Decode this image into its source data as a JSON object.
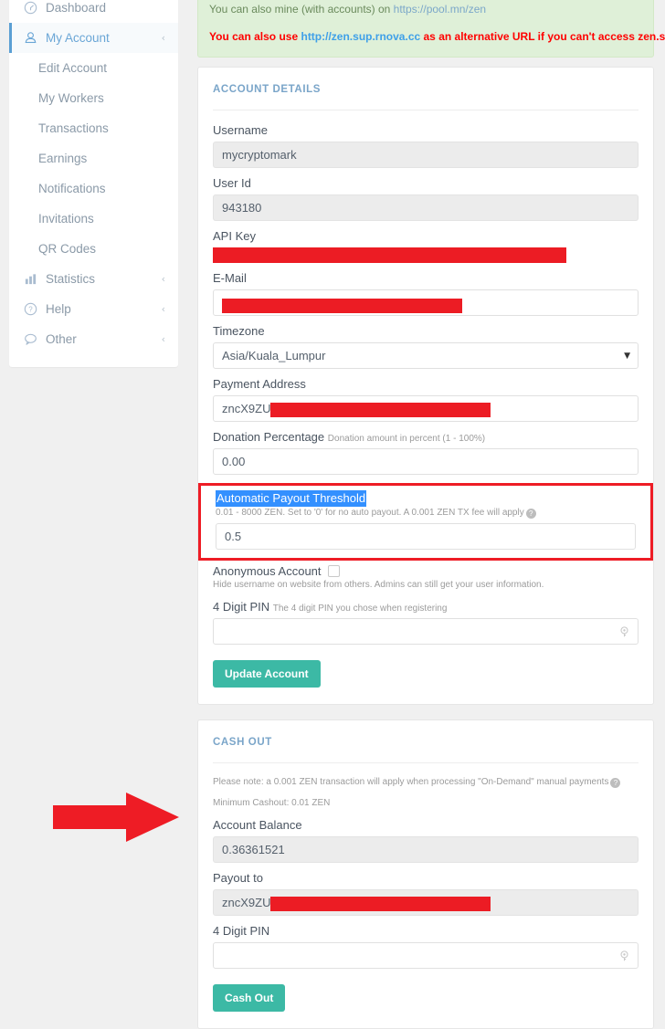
{
  "colors": {
    "accent_blue": "#5a9fd4",
    "panel_title": "#7aa5c9",
    "button_teal": "#3cb9a5",
    "redaction_red": "#ec1c24",
    "annotation_red": "#ee1c25",
    "alert_green_bg": "#dff0d8",
    "selection_blue": "#3390ff"
  },
  "sidebar": {
    "items": [
      {
        "label": "Dashboard",
        "icon": "dashboard-gauge-icon",
        "chevron": "",
        "active": false
      },
      {
        "label": "My Account",
        "icon": "user-icon",
        "chevron": "‹",
        "active": true
      }
    ],
    "sub_items": [
      {
        "label": "Edit Account"
      },
      {
        "label": "My Workers"
      },
      {
        "label": "Transactions"
      },
      {
        "label": "Earnings"
      },
      {
        "label": "Notifications"
      },
      {
        "label": "Invitations"
      },
      {
        "label": "QR Codes"
      }
    ],
    "bottom_items": [
      {
        "label": "Statistics",
        "icon": "bar-chart-icon",
        "chevron": "‹"
      },
      {
        "label": "Help",
        "icon": "question-circle-icon",
        "chevron": "‹"
      },
      {
        "label": "Other",
        "icon": "comment-bubble-icon",
        "chevron": "‹"
      }
    ]
  },
  "alerts": {
    "line1_prefix": "You can also mine (with accounts) on ",
    "line1_link": "https://pool.mn/zen",
    "line2_prefix": "You can also use ",
    "line2_link": "http://zen.sup.rnova.cc",
    "line2_suffix": " as an alternative URL if you can't access zen.suprnova.cc"
  },
  "account_details": {
    "title": "ACCOUNT DETAILS",
    "username": {
      "label": "Username",
      "value": "mycryptomark"
    },
    "user_id": {
      "label": "User Id",
      "value": "943180"
    },
    "api_key": {
      "label": "API Key",
      "value": ""
    },
    "email": {
      "label": "E-Mail",
      "value": ""
    },
    "timezone": {
      "label": "Timezone",
      "value": "Asia/Kuala_Lumpur"
    },
    "payment_address": {
      "label": "Payment Address",
      "value": "zncX9ZU"
    },
    "donation": {
      "label": "Donation Percentage",
      "hint": "Donation amount in percent (1 - 100%)",
      "value": "0.00"
    },
    "payout_threshold": {
      "label": "Automatic Payout Threshold",
      "help": "0.01 - 8000 ZEN. Set to '0' for no auto payout. A 0.001 ZEN TX fee will apply",
      "value": "0.5",
      "selected": true,
      "highlighted_box": true
    },
    "anonymous": {
      "label": "Anonymous Account",
      "checked": false,
      "help": "Hide username on website from others. Admins can still get your user information."
    },
    "pin": {
      "label": "4 Digit PIN",
      "hint": "The 4 digit PIN you chose when registering",
      "value": ""
    },
    "update_button": "Update Account"
  },
  "cash_out": {
    "title": "CASH OUT",
    "note": "Please note: a 0.001 ZEN transaction will apply when processing \"On-Demand\" manual payments",
    "minimum": "Minimum Cashout: 0.01 ZEN",
    "balance": {
      "label": "Account Balance",
      "value": "0.36361521"
    },
    "payout_to": {
      "label": "Payout to",
      "value": "zncX9ZU"
    },
    "pin": {
      "label": "4 Digit PIN",
      "value": ""
    },
    "cash_out_button": "Cash Out"
  },
  "annotation": {
    "arrow": "red-right-arrow pointing at Account Balance"
  }
}
